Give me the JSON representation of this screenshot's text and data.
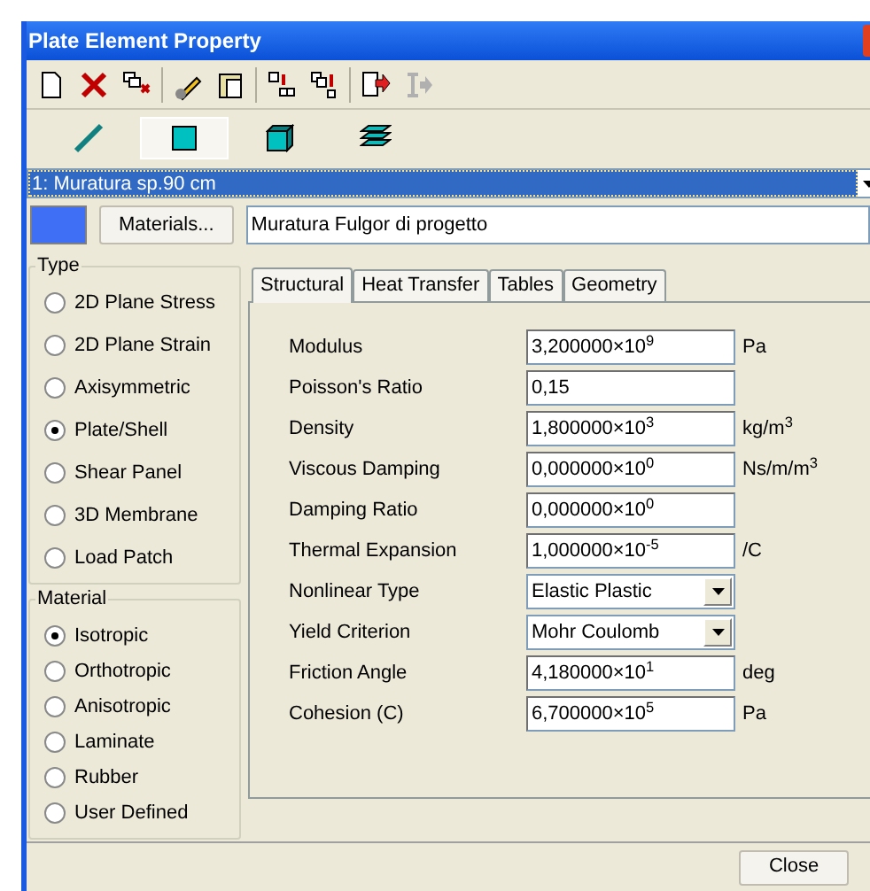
{
  "window": {
    "title": "Plate Element Property"
  },
  "toolbar": [
    {
      "kind": "new",
      "disabled": false
    },
    {
      "kind": "delete",
      "disabled": false
    },
    {
      "kind": "deletecopy",
      "disabled": false
    },
    {
      "kind": "edit",
      "disabled": false
    },
    {
      "kind": "paste",
      "disabled": false
    },
    {
      "kind": "copyto",
      "disabled": false
    },
    {
      "kind": "copy",
      "disabled": false
    },
    {
      "kind": "export",
      "disabled": false
    },
    {
      "kind": "import",
      "disabled": true
    }
  ],
  "element_types": [
    {
      "kind": "line",
      "selected": false
    },
    {
      "kind": "plate",
      "selected": true
    },
    {
      "kind": "brick",
      "selected": false
    },
    {
      "kind": "layers",
      "selected": false
    }
  ],
  "property_select": {
    "value": "1: Muratura sp.90 cm"
  },
  "material": {
    "color": "#3f6ff5",
    "button": "Materials...",
    "name": "Muratura Fulgor di progetto"
  },
  "type_group": {
    "title": "Type",
    "options": [
      {
        "label": "2D Plane Stress",
        "selected": false
      },
      {
        "label": "2D Plane Strain",
        "selected": false
      },
      {
        "label": "Axisymmetric",
        "selected": false
      },
      {
        "label": "Plate/Shell",
        "selected": true
      },
      {
        "label": "Shear Panel",
        "selected": false
      },
      {
        "label": "3D Membrane",
        "selected": false
      },
      {
        "label": "Load Patch",
        "selected": false
      }
    ]
  },
  "material_group": {
    "title": "Material",
    "options": [
      {
        "label": "Isotropic",
        "selected": true
      },
      {
        "label": "Orthotropic",
        "selected": false
      },
      {
        "label": "Anisotropic",
        "selected": false
      },
      {
        "label": "Laminate",
        "selected": false
      },
      {
        "label": "Rubber",
        "selected": false
      },
      {
        "label": "User Defined",
        "selected": false
      }
    ]
  },
  "tabs": [
    {
      "label": "Structural",
      "selected": true
    },
    {
      "label": "Heat Transfer",
      "selected": false
    },
    {
      "label": "Tables",
      "selected": false
    },
    {
      "label": "Geometry",
      "selected": false
    }
  ],
  "properties": [
    {
      "kind": "field",
      "label": "Modulus",
      "value": "3,200000×10$^{9}$",
      "unit": "Pa"
    },
    {
      "kind": "field",
      "label": "Poisson's Ratio",
      "value": "0,15"
    },
    {
      "kind": "field",
      "label": "Density",
      "value": "1,800000×10$^{3}$",
      "unit": "kg/m$^{3}$"
    },
    {
      "kind": "field",
      "label": "Viscous Damping",
      "value": "0,000000×10$^{0}$",
      "unit": "Ns/m/m$^{3}$"
    },
    {
      "kind": "field",
      "label": "Damping Ratio",
      "value": "0,000000×10$^{0}$"
    },
    {
      "kind": "field",
      "label": "Thermal Expansion",
      "value": "1,000000×10$^{-5}$",
      "unit": "/C"
    },
    {
      "kind": "dropdown",
      "label": "Nonlinear Type",
      "value": "Elastic Plastic"
    },
    {
      "kind": "dropdown",
      "label": "Yield Criterion",
      "value": "Mohr Coulomb"
    },
    {
      "kind": "field",
      "label": "Friction Angle",
      "value": "4,180000×10$^{1}$",
      "unit": "deg"
    },
    {
      "kind": "field",
      "label": "Cohesion (C)",
      "value": "6,700000×10$^{5}$",
      "unit": "Pa"
    }
  ],
  "close_button": "Close"
}
